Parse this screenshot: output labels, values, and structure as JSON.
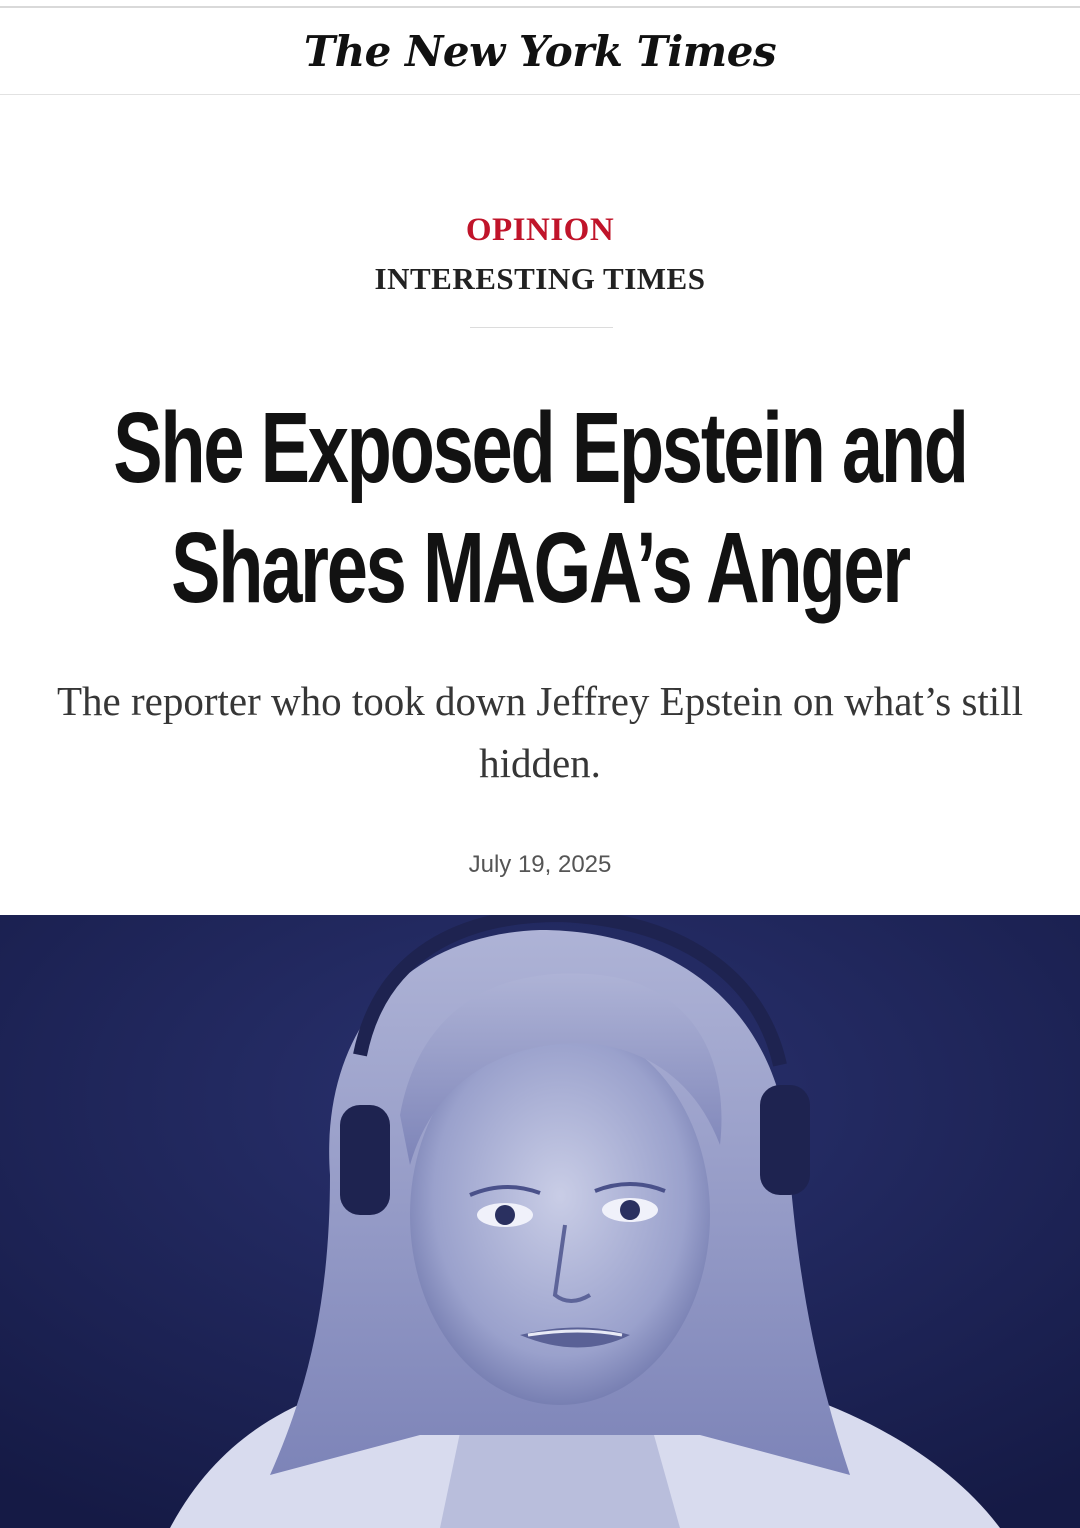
{
  "masthead": {
    "logo_text": "The New York Times"
  },
  "article": {
    "section": "OPINION",
    "column": "INTERESTING TIMES",
    "headline_line1": "She Exposed Epstein and",
    "headline_line2": "Shares MAGA’s Anger",
    "dek_line1": "The reporter who took down Jeffrey Epstein on what’s still",
    "dek_line2": "hidden.",
    "date": "July 19, 2025"
  },
  "colors": {
    "opinion_red": "#c0142a",
    "photo_duotone": "#1c2153"
  }
}
